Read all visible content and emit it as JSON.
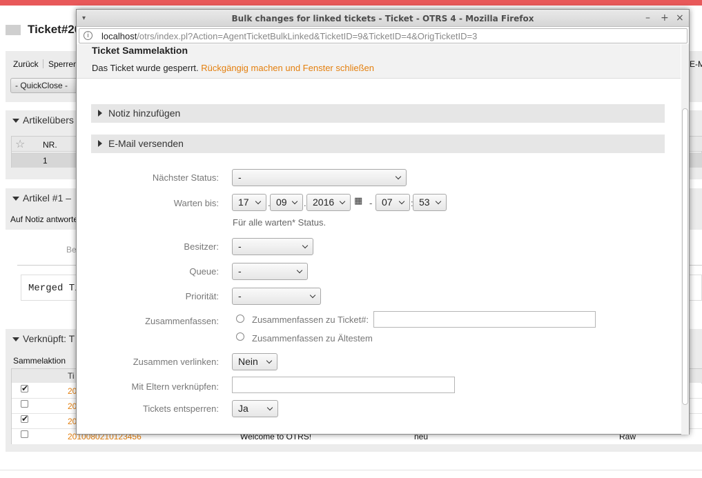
{
  "background_page": {
    "ticket_title": "Ticket#20",
    "menu": {
      "back": "Zurück",
      "lock": "Sperren",
      "email_right": "E-M"
    },
    "quickclose": "- QuickClose -",
    "article_overview": {
      "heading": "Artikelübers",
      "col_no": "NR.",
      "row_no": "1"
    },
    "article1": {
      "heading": "Artikel #1 –",
      "reply": "Auf Notiz antworte",
      "be": "Be",
      "merged": "Merged Ti"
    },
    "linked": {
      "heading": "Verknüpft: T",
      "bulk": "Sammelaktion",
      "col_t": "Ti",
      "rows": [
        {
          "checked": true,
          "ticket": "20"
        },
        {
          "checked": false,
          "ticket": "20"
        },
        {
          "checked": true,
          "ticket": "20"
        },
        {
          "checked": false,
          "ticket": "2010080210123456",
          "subject": "Welcome to OTRS!",
          "state": "neu",
          "type": "Raw"
        }
      ]
    }
  },
  "window": {
    "title": "Bulk changes for linked tickets - Ticket - OTRS 4 - Mozilla Firefox",
    "url_host": "localhost",
    "url_path": "/otrs/index.pl?Action=AgentTicketBulkLinked&TicketID=9&TicketID=4&OrigTicketID=3",
    "controls": {
      "minimize": "–",
      "maximize": "+",
      "close": "×"
    }
  },
  "dialog": {
    "heading": "Ticket Sammelaktion",
    "locked_msg": "Das Ticket wurde gesperrt.",
    "undo_link": "Rückgängig machen und Fenster schließen",
    "sections": [
      "Notiz hinzufügen",
      "E-Mail versenden"
    ],
    "fields": {
      "next_state": {
        "label": "Nächster Status:",
        "value": "-"
      },
      "pending_until": {
        "label": "Warten bis:",
        "day": "17",
        "month": "09",
        "year": "2016",
        "hour": "07",
        "minute": "53",
        "hint": "Für alle warten* Status."
      },
      "owner": {
        "label": "Besitzer:",
        "value": "-"
      },
      "queue": {
        "label": "Queue:",
        "value": "-"
      },
      "priority": {
        "label": "Priorität:",
        "value": "-"
      },
      "merge": {
        "label": "Zusammenfassen:",
        "option_ticket": "Zusammenfassen zu Ticket#:",
        "option_oldest": "Zusammenfassen zu Ältestem",
        "ticket_value": ""
      },
      "link_together": {
        "label": "Zusammen verlinken:",
        "value": "Nein"
      },
      "link_parent": {
        "label": "Mit Eltern verknüpfen:",
        "value": ""
      },
      "unlock": {
        "label": "Tickets entsperren:",
        "value": "Ja"
      }
    }
  }
}
